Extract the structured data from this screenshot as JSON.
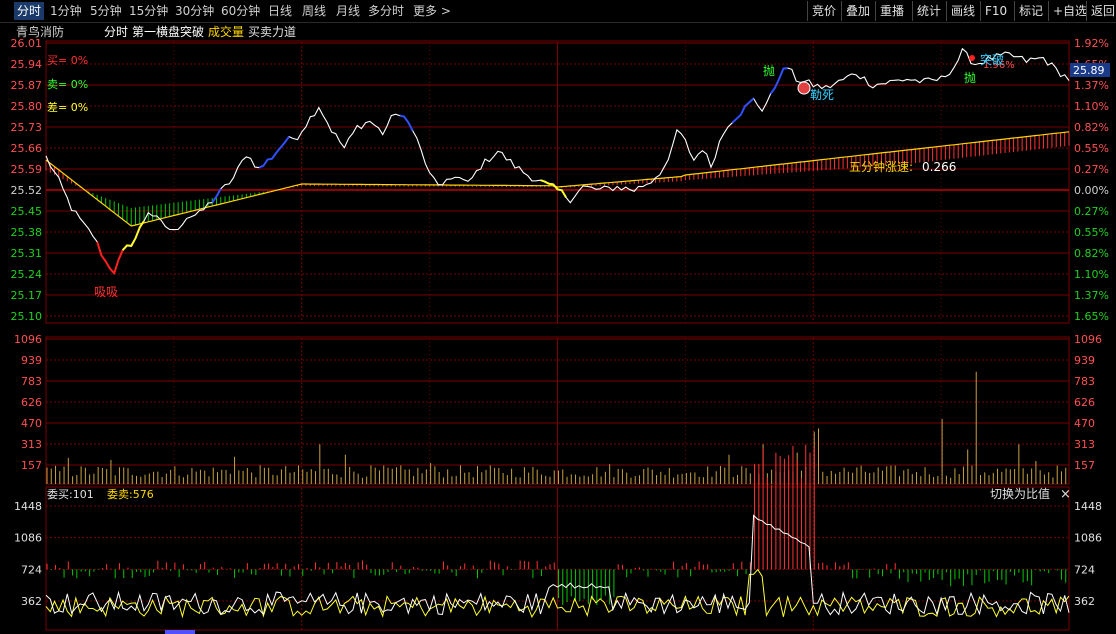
{
  "toolbar": {
    "period_tabs": [
      "分时",
      "1分钟",
      "5分钟",
      "15分钟",
      "30分钟",
      "60分钟",
      "日线",
      "周线",
      "月线",
      "多分时",
      "更多 >"
    ],
    "active_tab": "分时",
    "right_buttons": [
      "竞价",
      "叠加",
      "重播",
      "统计",
      "画线",
      "F10",
      "标记",
      "+自选",
      "返回"
    ]
  },
  "title_bar": {
    "stock_name": "青鸟消防",
    "view": "分时",
    "strategy": "第一横盘突破",
    "volume_label": "成交量",
    "force_label": "买卖力道"
  },
  "price_panel": {
    "price_axis": [
      "26.01",
      "25.94",
      "25.87",
      "25.80",
      "25.73",
      "25.66",
      "25.59",
      "25.52",
      "25.45",
      "25.38",
      "25.31",
      "25.24",
      "25.17",
      "25.10"
    ],
    "pct_axis": [
      "1.92%",
      "1.65%",
      "1.37%",
      "1.10%",
      "0.82%",
      "0.55%",
      "0.27%",
      "0.00%",
      "0.27%",
      "0.55%",
      "0.82%",
      "1.10%",
      "1.37%",
      "1.65%"
    ],
    "legend": {
      "buy": "买= 0%",
      "sell": "卖= 0%",
      "diff": "差= 0%"
    },
    "current_price": "25.89",
    "partial_top_label": "1.96%",
    "speed_label": "五分钟涨速:",
    "speed_value": "0.266",
    "annotations": {
      "suck": "吸吸",
      "throw1": "抛",
      "throw2": "抛",
      "dead": "勒死",
      "breakout": "突破"
    }
  },
  "volume_panel": {
    "axis": [
      "1096",
      "939",
      "783",
      "626",
      "470",
      "313",
      "157"
    ]
  },
  "force_panel": {
    "order_buy_label": "委买:",
    "order_buy_value": "101",
    "order_sell_label": "委卖:",
    "order_sell_value": "576",
    "switch_label": "切换为比值",
    "close_symbol": "×",
    "axis": [
      "1448",
      "1086",
      "724",
      "362"
    ]
  },
  "colors": {
    "grid": "#7a0000",
    "price_line": "#ffffff",
    "avg_line": "#ffd700",
    "up": "#ff3232",
    "down": "#00c800",
    "volume": "#c8a040",
    "axis_red": "#ff5050",
    "axis_green": "#20d020"
  }
}
